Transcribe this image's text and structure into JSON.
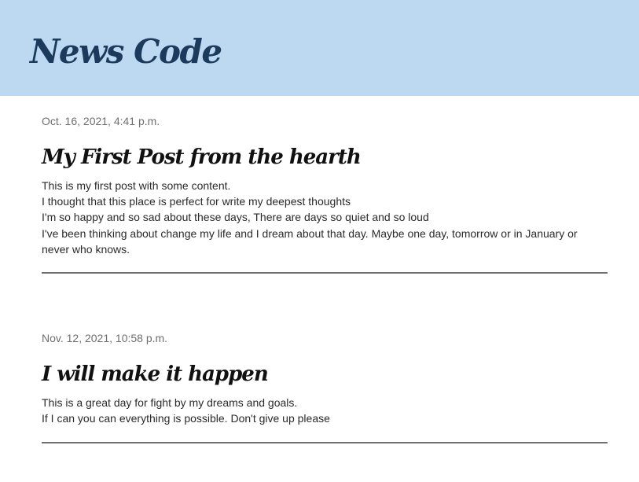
{
  "header": {
    "title": "News Code"
  },
  "posts": [
    {
      "date": "Oct. 16, 2021, 4:41 p.m.",
      "title": "My First Post from the hearth",
      "body": [
        "This is my first post with some content.",
        "I thought that this place is perfect for write my deepest thoughts",
        "I'm so happy and so sad about these days, There are days so quiet and so loud",
        "I've been thinking about change my life and I dream about that day. Maybe one day, tomorrow or in January or never who knows."
      ]
    },
    {
      "date": "Nov. 12, 2021, 10:58 p.m.",
      "title": "I will make it happen",
      "body": [
        "This is a great day for fight by my dreams and goals.",
        "If I can you can everything is possible. Don't give up please"
      ]
    }
  ],
  "colors": {
    "header_background": "#bcd9f1",
    "brand_title": "#1b3a5c",
    "date_text": "#6f6f6f",
    "divider": "#6f6f6f"
  }
}
